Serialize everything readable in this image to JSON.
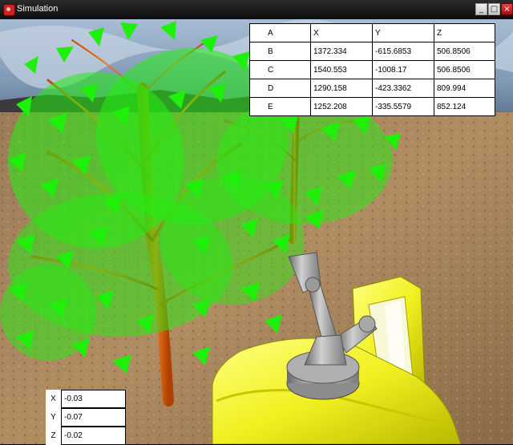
{
  "window": {
    "title": "Simulation",
    "controls": {
      "minimize": "_",
      "maximize": "□",
      "close": "×"
    }
  },
  "coords_table": {
    "header": [
      "A",
      "X",
      "Y",
      "Z"
    ],
    "rows": [
      [
        "B",
        "1372.334",
        "-615.6853",
        "506.8506"
      ],
      [
        "C",
        "1540.553",
        "-1008.17",
        "506.8506"
      ],
      [
        "D",
        "1290.158",
        "-423.3362",
        "809.994"
      ],
      [
        "E",
        "1252.208",
        "-335.5579",
        "852.124"
      ]
    ]
  },
  "rotation_panel": {
    "rows": [
      {
        "label": "X",
        "value": "-0.03"
      },
      {
        "label": "Y",
        "value": "-0.07"
      },
      {
        "label": "Z",
        "value": "-0.02"
      }
    ]
  }
}
